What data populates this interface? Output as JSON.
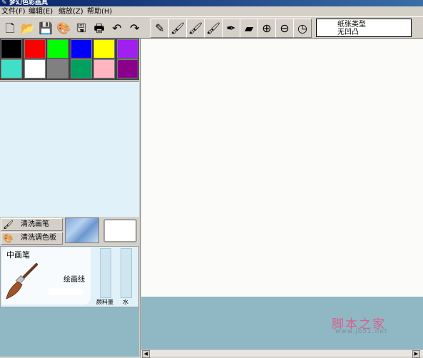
{
  "window": {
    "title": "梦幻色彩画具",
    "icon": "app-pen-icon"
  },
  "menu": {
    "items": [
      "文件(F)",
      "编辑(E)",
      "缩放(Z)",
      "帮助(H)"
    ]
  },
  "toolbar": {
    "file_tools": [
      {
        "name": "new-file-icon",
        "glyph": "🗋"
      },
      {
        "name": "open-file-icon",
        "glyph": "📂"
      },
      {
        "name": "save-icon",
        "glyph": "💾"
      },
      {
        "name": "palette-icon",
        "glyph": "🎨"
      },
      {
        "name": "save-image-icon",
        "glyph": "🖫"
      },
      {
        "name": "print-icon",
        "glyph": "🖶"
      },
      {
        "name": "undo-icon",
        "glyph": "↶"
      },
      {
        "name": "redo-icon",
        "glyph": "↷"
      }
    ],
    "brush_tools": [
      {
        "name": "pencil-icon",
        "glyph": "✎"
      },
      {
        "name": "small-brush-icon",
        "glyph": "🖌"
      },
      {
        "name": "medium-brush-icon",
        "glyph": "🖌"
      },
      {
        "name": "flat-brush-icon",
        "glyph": "🖌"
      },
      {
        "name": "pen-icon",
        "glyph": "✒"
      },
      {
        "name": "eraser-icon",
        "glyph": "▰"
      },
      {
        "name": "zoom-in-icon",
        "glyph": "⊕"
      },
      {
        "name": "zoom-out-icon",
        "glyph": "⊖"
      },
      {
        "name": "clock-icon",
        "glyph": "◷"
      }
    ]
  },
  "paper": {
    "label": "纸张类型",
    "value": "无凹凸",
    "swatch_color": "#f1f1ee"
  },
  "palette": {
    "row1": [
      "#000000",
      "#ff0000",
      "#00ff00",
      "#0000ff",
      "#ffff00",
      "#a020f0"
    ],
    "row2": [
      "#40e0c8",
      "#ffffff",
      "#808080",
      "#00a060",
      "#ffb6c1",
      "#8b008b"
    ]
  },
  "left_panel": {
    "clean_brush": "清洗画笔",
    "clean_palette": "清洗调色板",
    "brush_size": "中画笔",
    "stroke_label": "绘画线",
    "paint_amount_label": "颜料量",
    "water_label": "水"
  },
  "watermark": {
    "title": "脚本之家",
    "url": "www.jb51.net"
  },
  "colors": {
    "canvas": "#fbfcfa",
    "panel": "#e1f1f9",
    "frame": "#90b8c4"
  }
}
